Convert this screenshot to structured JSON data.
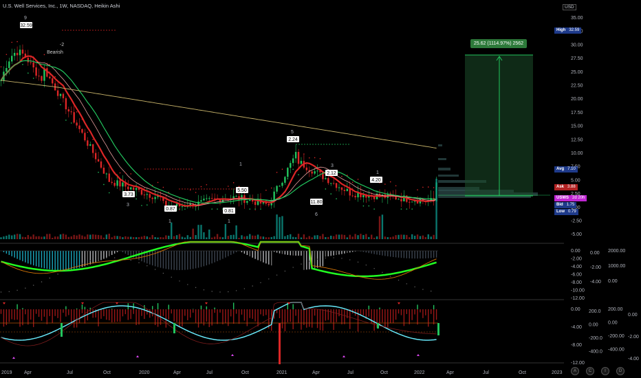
{
  "header": {
    "title": "U.S. Well Services, Inc., 1W, NASDAQ, Heikin Ashi",
    "currency": "USD"
  },
  "price_scale": [
    "35.00",
    "32.50",
    "30.00",
    "27.50",
    "25.00",
    "22.50",
    "20.00",
    "17.50",
    "15.00",
    "12.50",
    "10.00",
    "7.50",
    "5.00",
    "2.50",
    "0.00",
    "-2.50",
    "-5.00"
  ],
  "price_boxes": {
    "high": {
      "label": "High",
      "value": "32.59",
      "color": "#1e3a8a"
    },
    "avg": {
      "label": "Avg",
      "value": "7.10",
      "color": "#1e3a8a"
    },
    "ask": {
      "label": "Ask",
      "value": "3.88",
      "color": "#b22222"
    },
    "symbol": {
      "label": "USWS",
      "value": "2d 20h",
      "color": "#c026d3"
    },
    "bid": {
      "label": "Bid",
      "value": "1.75",
      "color": "#1e3a8a"
    },
    "low": {
      "label": "Low",
      "value": "0.79",
      "color": "#1e3a8a"
    }
  },
  "target_label": "25.62 (1114.97%) 2562",
  "annotations": {
    "counts": [
      "9",
      "3",
      "1",
      "1",
      "5",
      "6",
      "1",
      "1",
      "3"
    ],
    "bearish": "Bearish",
    "minus2": "-2",
    "prices": [
      "32.59",
      "3.73",
      "0.87",
      "0.81",
      "2.24",
      "11.80",
      "2.12",
      "5.50",
      "4.20"
    ]
  },
  "panel1_scale": [
    "0.00",
    "-2.00",
    "-4.00",
    "-6.00",
    "-8.00",
    "-10.00",
    "-12.00"
  ],
  "panel1_scale2": [
    "0.00",
    "-2.00",
    "-4.00"
  ],
  "panel1_scale3": [
    "2000.00",
    "1000.00",
    "0.00"
  ],
  "panel2_scale": [
    "0.00",
    "-4.00",
    "-8.00",
    "-12.00",
    "-16.00"
  ],
  "panel2_scale2": [
    "200.0",
    "0.00",
    "-200.0",
    "-400.0"
  ],
  "panel2_scale3": [
    "200.00",
    "0.00",
    "-200.00",
    "-400.00"
  ],
  "panel2_scale4": [
    "0.00",
    "-2.00",
    "-4.00"
  ],
  "time_axis": [
    "2019",
    "Apr",
    "Jul",
    "Oct",
    "2020",
    "Apr",
    "Jul",
    "Oct",
    "2021",
    "Apr",
    "Jul",
    "Oct",
    "2022",
    "Apr",
    "Jul",
    "Oct",
    "2023"
  ],
  "bottom_buttons": [
    "A",
    "C",
    "I",
    "D"
  ],
  "colors": {
    "up": "#26a69a",
    "down": "#ef5350",
    "green": "#00ff00",
    "red": "#ff0000",
    "sma": "#c8b46a",
    "cyan": "#4dd0e1",
    "bg": "#000000"
  }
}
